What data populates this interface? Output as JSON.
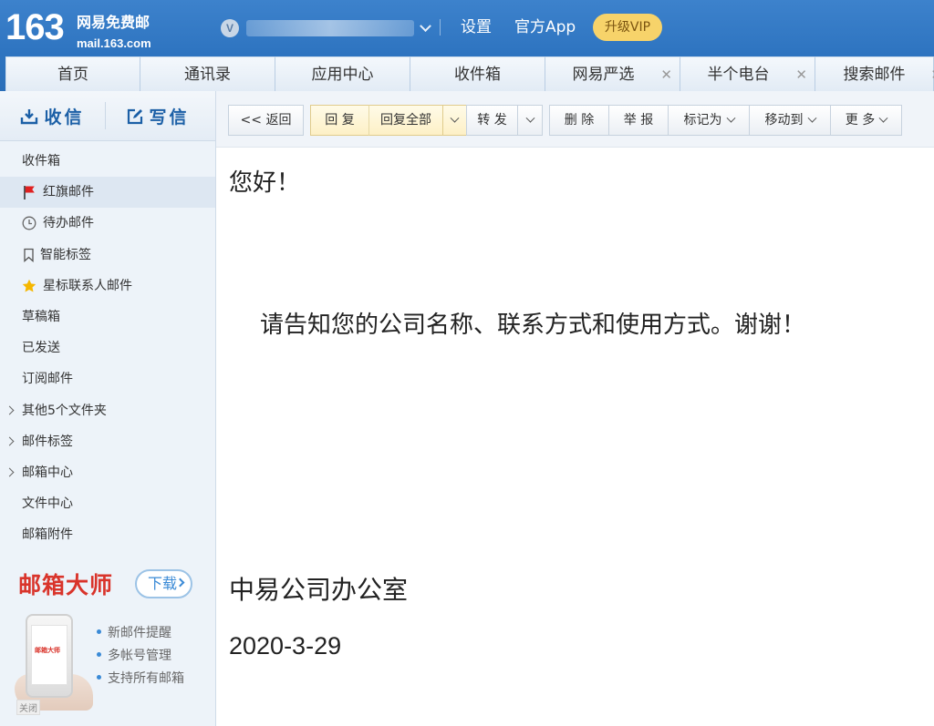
{
  "brand": {
    "number": "163",
    "name_cn": "网易免费邮",
    "domain": "mail.163.com"
  },
  "user": {
    "badge": "V"
  },
  "header_links": {
    "settings": "设置",
    "app": "官方App",
    "vip": "升级VIP"
  },
  "tabs": [
    {
      "label": "首页",
      "closable": false
    },
    {
      "label": "通讯录",
      "closable": false
    },
    {
      "label": "应用中心",
      "closable": false
    },
    {
      "label": "收件箱",
      "closable": false
    },
    {
      "label": "网易严选",
      "closable": true
    },
    {
      "label": "半个电台",
      "closable": true
    },
    {
      "label": "搜索邮件",
      "closable": true
    }
  ],
  "compose": {
    "receive": "收信",
    "write": "写信"
  },
  "sidebar": {
    "items": [
      {
        "label": "收件箱"
      },
      {
        "label": "红旗邮件",
        "icon": "red-flag-icon"
      },
      {
        "label": "待办邮件",
        "icon": "clock-icon"
      },
      {
        "label": "智能标签",
        "icon": "bookmark-icon"
      },
      {
        "label": "星标联系人邮件",
        "icon": "star-icon"
      },
      {
        "label": "草稿箱"
      },
      {
        "label": "已发送"
      },
      {
        "label": "订阅邮件"
      },
      {
        "label": "其他5个文件夹",
        "expandable": true
      },
      {
        "label": "邮件标签",
        "expandable": true
      },
      {
        "label": "邮箱中心",
        "expandable": true
      },
      {
        "label": "文件中心"
      },
      {
        "label": "邮箱附件"
      }
    ]
  },
  "promo": {
    "title": "邮箱大师",
    "download": "下载",
    "phone_logo": "邮箱大师",
    "features": [
      "新邮件提醒",
      "多帐号管理",
      "支持所有邮箱"
    ],
    "close": "关闭"
  },
  "toolbar": {
    "back": "<< 返回",
    "reply": "回 复",
    "reply_all": "回复全部",
    "forward": "转 发",
    "delete": "删 除",
    "report": "举 报",
    "mark_as": "标记为",
    "move_to": "移动到",
    "more": "更 多"
  },
  "mail": {
    "greeting": "您好！",
    "body": "请告知您的公司名称、联系方式和使用方式。谢谢！",
    "signature": "中易公司办公室",
    "date": "2020-3-29"
  },
  "colors": {
    "header_blue": "#3d82cc",
    "vip_yellow": "#f7d36a",
    "compose_blue": "#1b5fa6",
    "promo_red": "#d9342b"
  }
}
